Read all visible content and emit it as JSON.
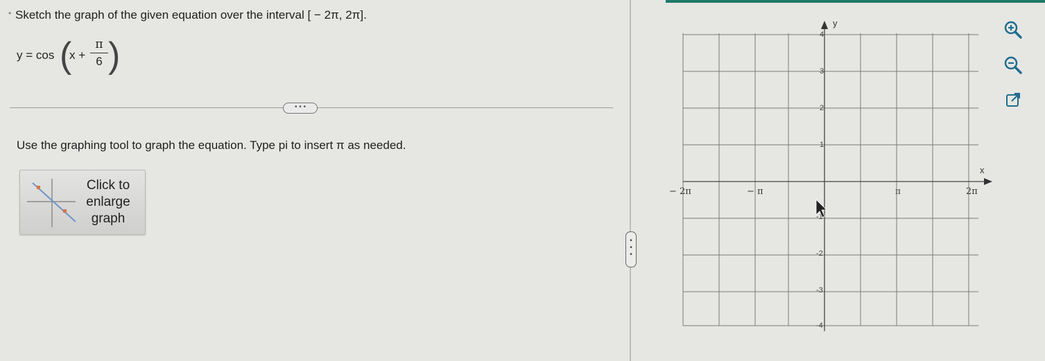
{
  "problem": {
    "instruction": "Sketch the graph of the given equation over the interval [ − 2π, 2π].",
    "equation": {
      "lhs": "y = cos",
      "inner": "x +",
      "numerator": "π",
      "denominator": "6"
    },
    "collapse_label": "• • •",
    "graph_instruction": "Use the graphing tool to graph the equation. Type pi to insert π as needed."
  },
  "enlarge_button": {
    "label_lines": [
      "Click to",
      "enlarge",
      "graph"
    ]
  },
  "splitter": {
    "handle_label": "⋮"
  },
  "graph": {
    "x_axis_label": "x",
    "y_axis_label": "y",
    "x_tick_labels": [
      "− 2π",
      "− π",
      "π",
      "2π"
    ],
    "y_tick_labels": [
      "4",
      "3",
      "2",
      "1",
      "-1",
      "-2",
      "-3",
      "-4"
    ]
  },
  "tools": {
    "zoom_in": "zoom-in-icon",
    "zoom_out": "zoom-out-icon",
    "popout": "external-link-icon"
  },
  "colors": {
    "accent": "#1f7a6a",
    "icon": "#1f6d8c",
    "grid": "#7a7a7a"
  }
}
